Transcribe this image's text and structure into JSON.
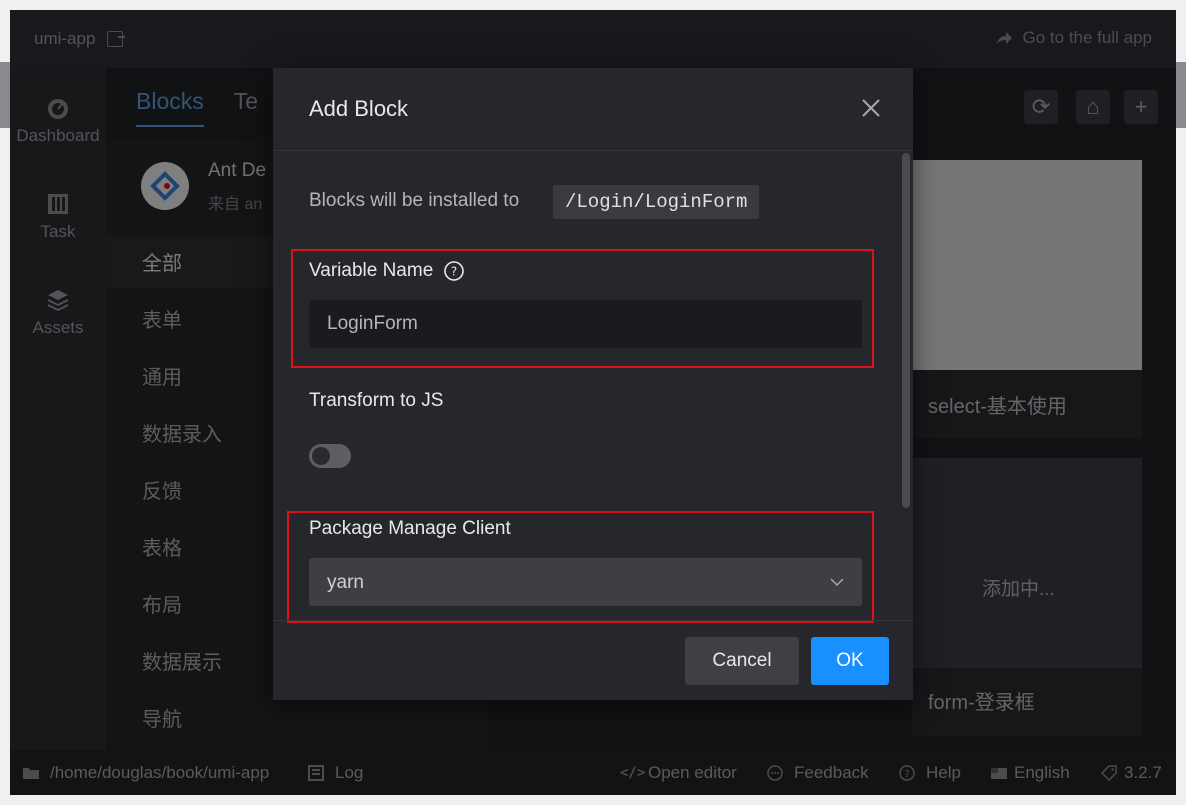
{
  "topbar": {
    "title": "umi-app",
    "title_icon": "external-link-icon",
    "full_app_label": "Go to the full app",
    "full_app_icon": "share-icon"
  },
  "sidebar": {
    "items": [
      {
        "label": "Dashboard",
        "icon": "dashboard-icon"
      },
      {
        "label": "Task",
        "icon": "task-icon"
      },
      {
        "label": "Assets",
        "icon": "stack-icon"
      }
    ]
  },
  "main": {
    "tabs": [
      {
        "label": "Blocks"
      },
      {
        "label": "Te"
      }
    ],
    "toolbar_icons": [
      "reload-icon",
      "clear-icon",
      "plus-icon"
    ],
    "library": {
      "name": "Ant De",
      "desc": "来自 an"
    },
    "categories": [
      "全部",
      "表单",
      "通用",
      "数据录入",
      "反馈",
      "表格",
      "布局",
      "数据展示",
      "导航"
    ],
    "cards": [
      {
        "label": "select-基本使用"
      },
      {
        "label": "form-登录框"
      }
    ],
    "adding_label": "添加中..."
  },
  "modal": {
    "title": "Add Block",
    "install_text": "Blocks will be installed to",
    "install_path": "/Login/LoginForm",
    "variable_name_label": "Variable Name",
    "variable_name_value": "LoginForm",
    "transform_label": "Transform to JS",
    "transform_enabled": false,
    "package_client_label": "Package Manage Client",
    "package_client_value": "yarn",
    "cancel_label": "Cancel",
    "ok_label": "OK"
  },
  "statusbar": {
    "path": "/home/douglas/book/umi-app",
    "log": "Log",
    "open_editor": "Open editor",
    "feedback": "Feedback",
    "help": "Help",
    "language": "English",
    "version": "3.2.7"
  },
  "colors": {
    "primary": "#1890ff",
    "highlight_border": "#e0101a"
  }
}
